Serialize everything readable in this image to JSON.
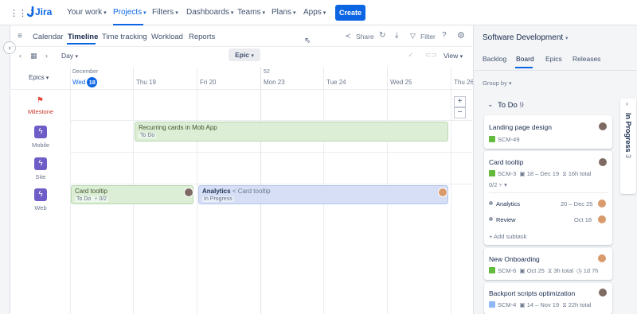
{
  "brand": {
    "name": "Jira"
  },
  "topnav": {
    "items": [
      "Your work",
      "Projects",
      "Filters",
      "Dashboards",
      "Teams",
      "Plans",
      "Apps"
    ],
    "create_label": "Create"
  },
  "subnav": {
    "tabs": [
      "Calendar",
      "Timeline",
      "Time tracking",
      "Workload",
      "Reports"
    ],
    "share_label": "Share",
    "filter_label": "Filter"
  },
  "toolbar": {
    "scale": "Day",
    "group": "Epic",
    "view": "View"
  },
  "timeline": {
    "column_header": "Epics",
    "month": "December",
    "week_no": "52",
    "days": [
      {
        "name": "Wed",
        "num": "18",
        "today": true
      },
      {
        "name": "Thu",
        "num": "19"
      },
      {
        "name": "Fri",
        "num": "20"
      },
      {
        "name": "Mon",
        "num": "23"
      },
      {
        "name": "Tue",
        "num": "24"
      },
      {
        "name": "Wed",
        "num": "25"
      },
      {
        "name": "Thu",
        "num": "26"
      }
    ],
    "rows": [
      {
        "label": "Milestone",
        "icon": "flag-icon"
      },
      {
        "label": "Mobile",
        "icon": "lightning-icon"
      },
      {
        "label": "Site",
        "icon": "lightning-icon"
      },
      {
        "label": "Web",
        "icon": "lightning-icon"
      }
    ],
    "bars": [
      {
        "title": "Recurring cards in Mob App",
        "status": "To Do"
      },
      {
        "title": "Card tooltip",
        "status": "To Do",
        "subtasks": "0/2"
      },
      {
        "title": "Analytics",
        "parent": "< Card tooltip",
        "status": "In Progress"
      }
    ],
    "zoom_in": "+",
    "zoom_out": "−"
  },
  "panel": {
    "project": "Software Development",
    "tabs": [
      "Backlog",
      "Board",
      "Epics",
      "Releases"
    ],
    "group_by": "Group by",
    "todo_col": {
      "name": "To Do",
      "count": "9"
    },
    "inprogress_col": {
      "name": "In Progress",
      "count": "3"
    },
    "cards": [
      {
        "title": "Landing page design",
        "key": "SCM-49"
      },
      {
        "title": "Card tooltip",
        "key": "SCM-3",
        "dates": "18 – Dec 19",
        "estimate": "16h total",
        "subtasks": "0/2"
      },
      {
        "title": "New Onboarding",
        "key": "SCM-6",
        "dates": "Oct 25",
        "estimate": "3h total",
        "remaining": "1d 7h"
      },
      {
        "title": "Backport scripts optimization",
        "key": "SCM-4",
        "dates": "14 – Nov 19",
        "estimate": "22h total"
      }
    ],
    "subtasks": [
      {
        "name": "Analytics",
        "date": "20 – Dec 25"
      },
      {
        "name": "Review",
        "date": "Oct 18"
      }
    ],
    "add_subtask": "+ Add subtask"
  },
  "colors": {
    "accent": "#0c66e4",
    "epic_purple": "#6e5dc6",
    "bar_green": "#dcefd6",
    "bar_blue": "#d6dff5"
  }
}
